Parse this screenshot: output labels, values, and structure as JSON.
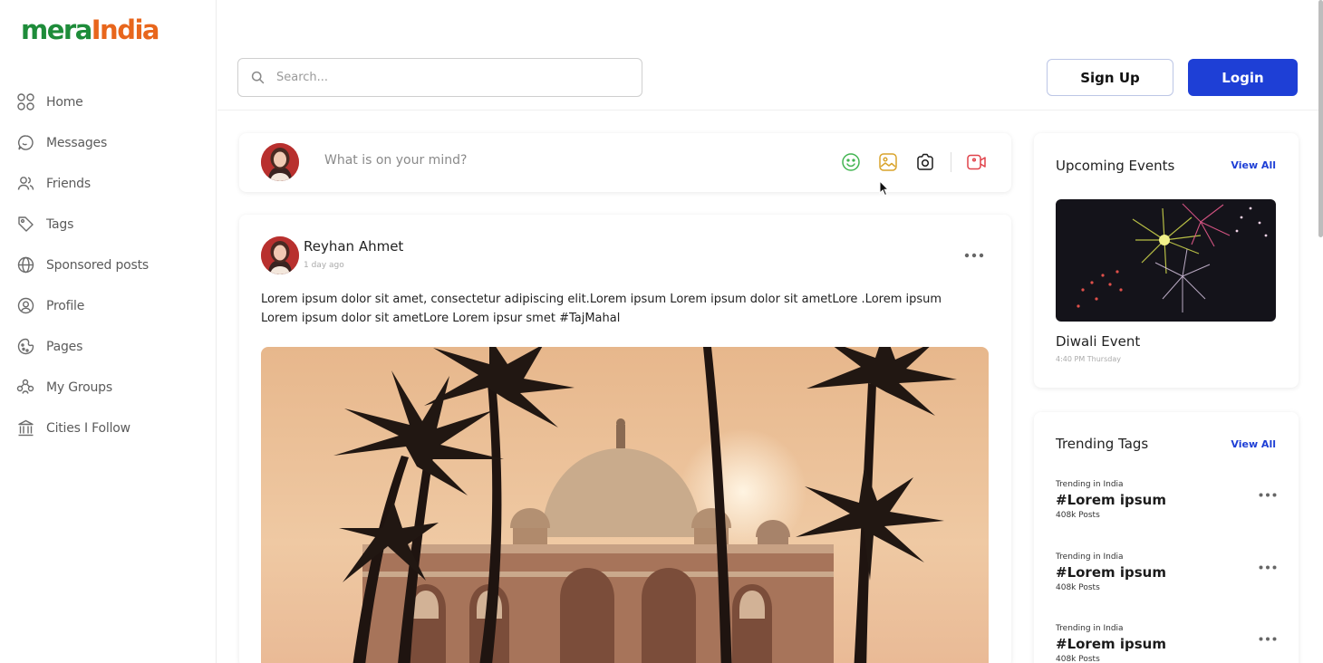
{
  "brand": {
    "logo_part1": "mera",
    "logo_part2": "India",
    "color_green": "#1e8c3a",
    "color_orange": "#e8661c"
  },
  "sidebar": {
    "items": [
      {
        "label": "Home",
        "icon": "grid-icon"
      },
      {
        "label": "Messages",
        "icon": "chat-bubble-icon"
      },
      {
        "label": "Friends",
        "icon": "users-icon"
      },
      {
        "label": "Tags",
        "icon": "tag-icon"
      },
      {
        "label": "Sponsored posts",
        "icon": "globe-icon"
      },
      {
        "label": "Profile",
        "icon": "user-circle-icon"
      },
      {
        "label": "Pages",
        "icon": "pages-icon"
      },
      {
        "label": "My Groups",
        "icon": "groups-icon"
      },
      {
        "label": "Cities I Follow",
        "icon": "building-icon"
      }
    ]
  },
  "header": {
    "search_placeholder": "Search...",
    "signup_label": "Sign Up",
    "login_label": "Login",
    "accent_color": "#1e3fd6"
  },
  "composer": {
    "prompt": "What is on your mind?",
    "tools": [
      "smiley-icon",
      "image-icon",
      "camera-icon",
      "video-icon"
    ]
  },
  "post": {
    "author": "Reyhan Ahmet",
    "time": "1 day ago",
    "text": "Lorem ipsum dolor sit amet, consectetur adipiscing elit.Lorem ipsum Lorem ipsum dolor sit ametLore .Lorem ipsum Lorem ipsum dolor sit ametLore Lorem ipsur smet #TajMahal"
  },
  "events": {
    "title": "Upcoming Events",
    "view_all": "View All",
    "event_name": "Diwali Event",
    "event_time": "4:40 PM Thursday"
  },
  "trending": {
    "title": "Trending Tags",
    "view_all": "View All",
    "tags": [
      {
        "sub": "Trending in India",
        "name": "#Lorem ipsum",
        "count": "408k Posts"
      },
      {
        "sub": "Trending in India",
        "name": "#Lorem ipsum",
        "count": "408k Posts"
      },
      {
        "sub": "Trending in India",
        "name": "#Lorem ipsum",
        "count": "408k Posts"
      }
    ]
  }
}
